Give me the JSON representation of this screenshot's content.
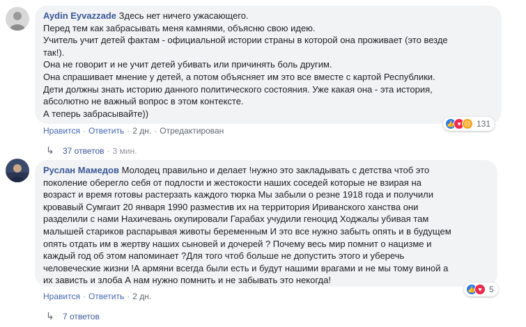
{
  "comments": [
    {
      "author": "Aydin Eyvazzade",
      "text_lines": [
        "Здесь нет ничего ужасающего.",
        "Перед тем как забрасывать меня камнями, объясню свою идею.",
        "Учитель учит детей фактам - официальной истории страны в которой она проживает (это везде",
        "так!).",
        "Она не говорит и не учит детей убивать или причинять боль другим.",
        "Она спрашивает мнение у детей, а потом объясняет им это все вместе с картой Республики.",
        "Дети должны знать историю данного политического состояния. Уже какая она - эта история,",
        "абсолютно не важный вопрос в этом контексте.",
        "А теперь забрасывайте))"
      ],
      "actions": {
        "like": "Нравится",
        "reply": "Ответить",
        "time": "2 дн.",
        "edited": "Отредактирован"
      },
      "reactions": {
        "icons": [
          "like-icon",
          "love-icon",
          "angry-icon"
        ],
        "count": "131"
      },
      "replies": {
        "label": "37 ответов",
        "time": "3 мин."
      }
    },
    {
      "author": "Руслан Мамедов",
      "first_line_text": "Молодец правильно и делает !нужно это закладывать с детства чтоб это",
      "text_lines": [
        "поколение оберегло себя от подлости и жестокости наших соседей которые не взирая на",
        "возраст и время готовы растерзать каждого тюрка Мы забыли о резне 1918 года и получили",
        "кровавый Сумгаит 20 января 1990 разместив их на территория Ириванского ханства они",
        "разделили с нами Нахичевань окупировали Гарабах учудили геноцид Ходжалы убивая там",
        "малышей стариков распарывая животы беременным И это все нужно забыть опять и в будущем",
        "опять отдать им в жертву наших сыновей и дочерей ? Почему весь мир помнит о нацизме и",
        "каждый год об этом напоминает ?Для того чтоб больше не допустить этого и уберечь",
        "человеческие жизни !А армяни всегда были есть и будут нашими врагами и не мы тому виной а",
        "их зависть и злоба А нам нужно помнить и не забывать это некогда!"
      ],
      "actions": {
        "like": "Нравится",
        "reply": "Ответить",
        "time": "2 дн."
      },
      "reactions": {
        "icons": [
          "like-icon",
          "love-icon"
        ],
        "count": "5"
      },
      "replies": {
        "label": "7 ответов"
      }
    }
  ],
  "colors": {
    "author": "#385898",
    "bubble": "#f2f3f5",
    "link": "#4267b2",
    "meta": "#90949c"
  }
}
